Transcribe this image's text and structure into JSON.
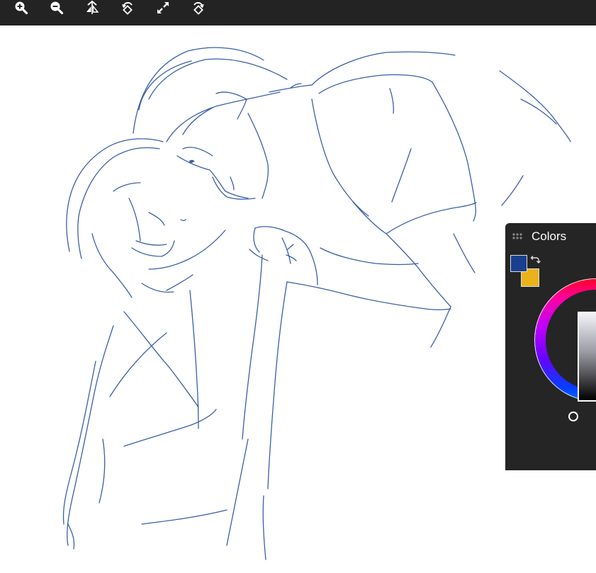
{
  "toolbar": {
    "tools": [
      {
        "name": "zoom-in-icon"
      },
      {
        "name": "zoom-out-icon"
      },
      {
        "name": "flip-horizontal-icon"
      },
      {
        "name": "rotate-left-icon"
      },
      {
        "name": "fullscreen-icon"
      },
      {
        "name": "rotate-right-icon"
      }
    ]
  },
  "canvas": {
    "stroke_color": "#3a5fa6",
    "background": "#ffffff"
  },
  "colors_panel": {
    "title": "Colors",
    "primary_color": "#1a3f8e",
    "secondary_color": "#eab21c",
    "icons": {
      "grip": "grip-icon",
      "swap": "swap-colors-icon"
    }
  }
}
